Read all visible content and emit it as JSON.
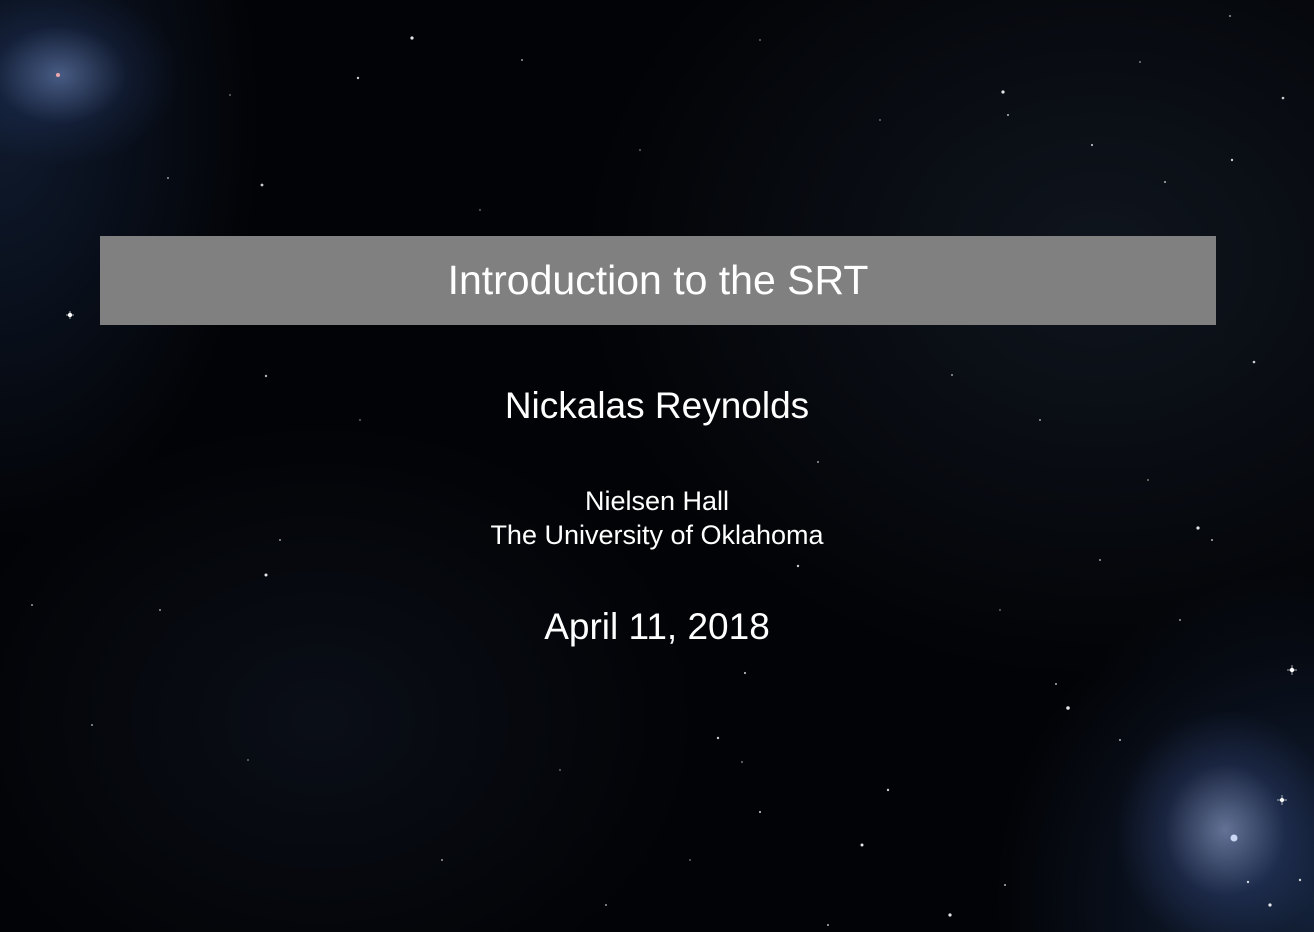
{
  "slide": {
    "title": "Introduction to the SRT",
    "author": "Nickalas Reynolds",
    "institute_line1": "Nielsen Hall",
    "institute_line2": "The University of Oklahoma",
    "date": "April 11, 2018"
  },
  "colors": {
    "title_bar": "#808080",
    "text": "#ffffff",
    "background": "#020306"
  }
}
